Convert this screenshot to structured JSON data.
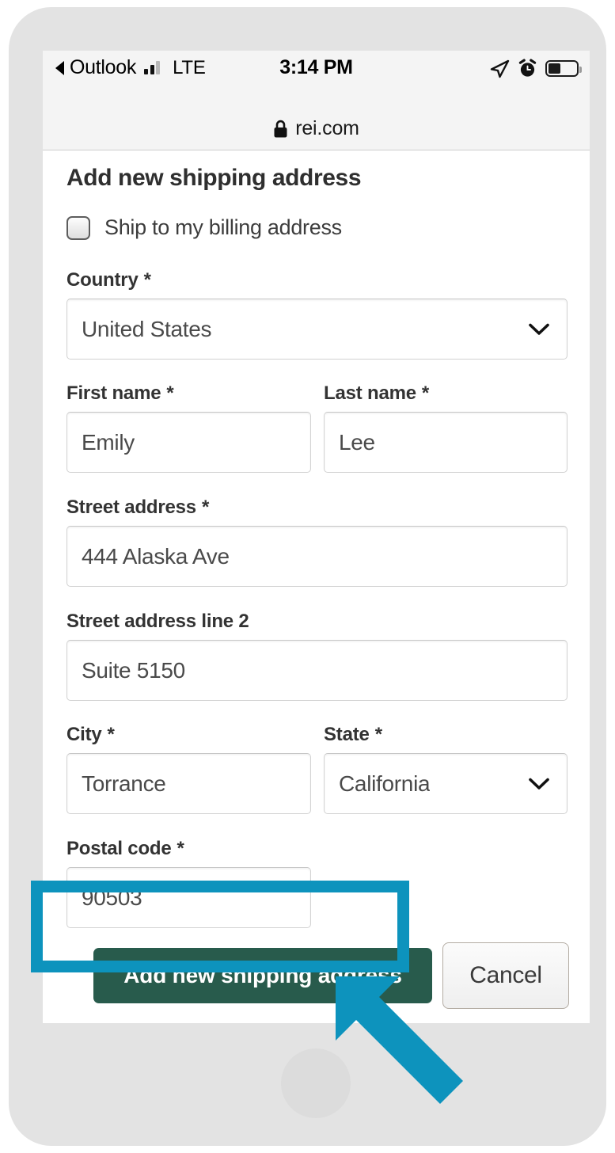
{
  "status_bar": {
    "back_app": "Outlook",
    "back_icon": "triangle-left-icon",
    "signal_icon": "cellular-signal-icon",
    "network": "LTE",
    "time": "3:14 PM",
    "location_icon": "location-arrow-icon",
    "alarm_icon": "alarm-clock-icon",
    "battery_icon": "battery-icon"
  },
  "browser": {
    "lock_icon": "lock-icon",
    "url": "rei.com"
  },
  "page": {
    "title": "Add new shipping address",
    "billing_checkbox": {
      "label": "Ship to my billing address",
      "checked": false,
      "icon": "checkbox-icon"
    },
    "required_marker": "*",
    "fields": [
      {
        "label": "Country",
        "required": true,
        "value": "United States",
        "type": "select",
        "icon": "chevron-down-icon"
      },
      {
        "label": "First name",
        "required": true,
        "value": "Emily",
        "type": "text"
      },
      {
        "label": "Last name",
        "required": true,
        "value": "Lee",
        "type": "text"
      },
      {
        "label": "Street address",
        "required": true,
        "value": "444 Alaska Ave",
        "type": "text"
      },
      {
        "label": "Street address line 2",
        "required": false,
        "value": "Suite 5150",
        "type": "text"
      },
      {
        "label": "City",
        "required": true,
        "value": "Torrance",
        "type": "text"
      },
      {
        "label": "State",
        "required": true,
        "value": "California",
        "type": "select",
        "icon": "chevron-down-icon"
      },
      {
        "label": "Postal code",
        "required": true,
        "value": "90503",
        "type": "text"
      }
    ],
    "actions": {
      "submit_label": "Add new shipping address",
      "cancel_label": "Cancel"
    },
    "chat_widget": {
      "icon": "chat-bubble-icon"
    }
  },
  "annotations": {
    "highlight_color": "#0d93bd",
    "arrow_icon": "arrow-up-left-icon",
    "target": "Add new shipping address"
  },
  "colors": {
    "brand_green": "#285b4c",
    "annotation_cyan": "#0d93bd",
    "frame_gray": "#e3e3e3",
    "status_bar_gray": "#f4f4f4"
  }
}
